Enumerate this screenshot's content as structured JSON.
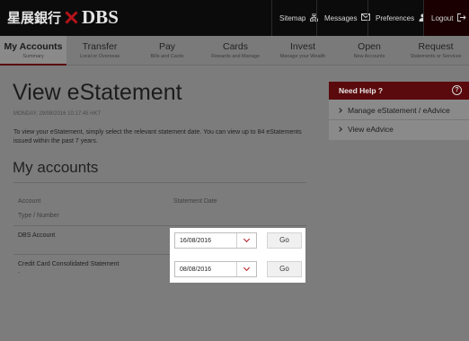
{
  "header": {
    "logo_cn": "星展銀行",
    "logo_en": "DBS",
    "utils": [
      {
        "label": "Sitemap",
        "icon": "sitemap-icon"
      },
      {
        "label": "Messages",
        "icon": "envelope-icon"
      },
      {
        "label": "Preferences",
        "icon": "user-icon"
      },
      {
        "label": "Logout",
        "icon": "logout-icon"
      }
    ]
  },
  "nav": [
    {
      "title": "My Accounts",
      "sub": "Summary"
    },
    {
      "title": "Transfer",
      "sub": "Local or Overseas"
    },
    {
      "title": "Pay",
      "sub": "Bills and Cards"
    },
    {
      "title": "Cards",
      "sub": "Rewards and Manage"
    },
    {
      "title": "Invest",
      "sub": "Manage your Wealth"
    },
    {
      "title": "Open",
      "sub": "New Accounts"
    },
    {
      "title": "Request",
      "sub": "Statements or Services"
    }
  ],
  "page": {
    "title": "View eStatement",
    "dateline": "MONDAY, 29/08/2016 10:17:45 HKT",
    "intro": "To view your eStatement, simply select the relevant statement date. You can view up to 84 eStatements issued within the past 7 years.",
    "section_title": "My accounts",
    "col_account": "Account",
    "col_type": "Type / Number",
    "col_date": "Statement Date",
    "rows": [
      {
        "label": "DBS Account",
        "dash": "",
        "date": "16/08/2016",
        "go": "Go"
      },
      {
        "label": "Credit Card Consolidated Statement",
        "dash": "-",
        "date": "08/08/2016",
        "go": "Go"
      }
    ]
  },
  "help": {
    "title": "Need Help ?",
    "q": "?",
    "items": [
      "Manage eStatement / eAdvice",
      "View eAdvice"
    ]
  }
}
